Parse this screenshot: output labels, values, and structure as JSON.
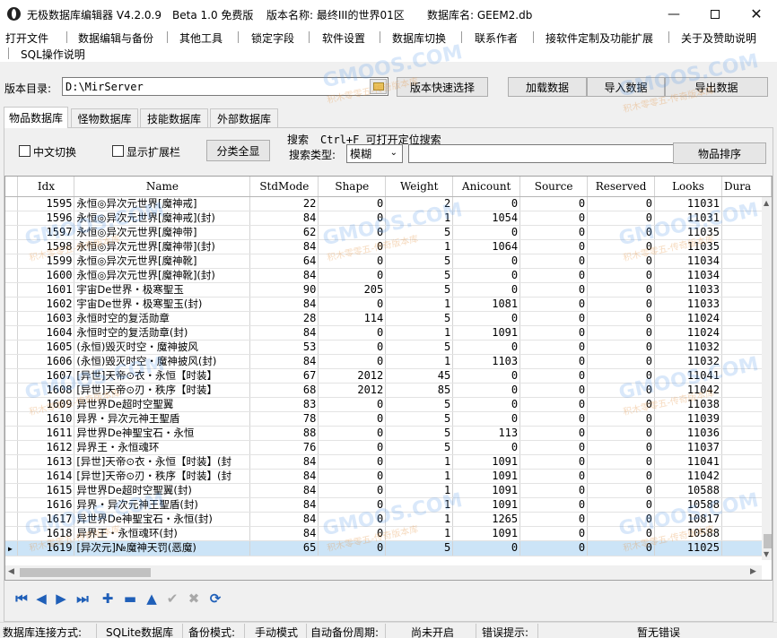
{
  "window": {
    "title": "无极数据库编辑器 V4.2.0.9",
    "edition": "Beta 1.0 免费版",
    "version_name": "版本名称: 最终III的世界01区",
    "db_name": "数据库名: GEEM2.db"
  },
  "menu": [
    "打开文件",
    "数据编辑与备份",
    "其他工具",
    "锁定字段",
    "软件设置",
    "数据库切换",
    "联系作者",
    "接软件定制及功能扩展",
    "关于及赞助说明",
    "SQL操作说明"
  ],
  "toolbar": {
    "path_label": "版本目录:",
    "path_value": "D:\\MirServer",
    "quick_select": "版本快速选择",
    "load": "加载数据",
    "import": "导入数据",
    "export": "导出数据"
  },
  "tabs": [
    "物品数据库",
    "怪物数据库",
    "技能数据库",
    "外部数据库"
  ],
  "filters": {
    "chinese_switch": "中文切换",
    "show_ext": "显示扩展栏",
    "show_all": "分类全显",
    "search_label": "搜索",
    "search_hint": "Ctrl+F 可打开定位搜索",
    "search_type_label": "搜索类型:",
    "search_type_value": "模糊",
    "sort_button": "物品排序"
  },
  "grid": {
    "columns": [
      "Idx",
      "Name",
      "StdMode",
      "Shape",
      "Weight",
      "Anicount",
      "Source",
      "Reserved",
      "Looks",
      "Dura"
    ],
    "rows": [
      [
        "1595",
        "永恒◎异次元世界[魔神戒]",
        "22",
        "0",
        "2",
        "0",
        "0",
        "0",
        "11031"
      ],
      [
        "1596",
        "永恒◎异次元世界[魔神戒](封)",
        "84",
        "0",
        "1",
        "1054",
        "0",
        "0",
        "11031"
      ],
      [
        "1597",
        "永恒◎异次元世界[魔神带]",
        "62",
        "0",
        "5",
        "0",
        "0",
        "0",
        "11035"
      ],
      [
        "1598",
        "永恒◎异次元世界[魔神带](封)",
        "84",
        "0",
        "1",
        "1064",
        "0",
        "0",
        "11035"
      ],
      [
        "1599",
        "永恒◎异次元世界[魔神靴]",
        "64",
        "0",
        "5",
        "0",
        "0",
        "0",
        "11034"
      ],
      [
        "1600",
        "永恒◎异次元世界[魔神靴](封)",
        "84",
        "0",
        "5",
        "0",
        "0",
        "0",
        "11034"
      ],
      [
        "1601",
        "宇宙De世界・极寒聖玉",
        "90",
        "205",
        "5",
        "0",
        "0",
        "0",
        "11033"
      ],
      [
        "1602",
        "宇宙De世界・极寒聖玉(封)",
        "84",
        "0",
        "1",
        "1081",
        "0",
        "0",
        "11033"
      ],
      [
        "1603",
        "永恒时空的复活勋章",
        "28",
        "114",
        "5",
        "0",
        "0",
        "0",
        "11024"
      ],
      [
        "1604",
        "永恒时空的复活勋章(封)",
        "84",
        "0",
        "1",
        "1091",
        "0",
        "0",
        "11024"
      ],
      [
        "1605",
        "(永恒)毁灭时空・魔神披风",
        "53",
        "0",
        "5",
        "0",
        "0",
        "0",
        "11032"
      ],
      [
        "1606",
        "(永恒)毁灭时空・魔神披风(封)",
        "84",
        "0",
        "1",
        "1103",
        "0",
        "0",
        "11032"
      ],
      [
        "1607",
        "[异世]天帝⊙衣・永恒【时装】",
        "67",
        "2012",
        "45",
        "0",
        "0",
        "0",
        "11041"
      ],
      [
        "1608",
        "[异世]天帝⊙刃・秩序【时装】",
        "68",
        "2012",
        "85",
        "0",
        "0",
        "0",
        "11042"
      ],
      [
        "1609",
        "异世界De超时空聖翼",
        "83",
        "0",
        "5",
        "0",
        "0",
        "0",
        "11038"
      ],
      [
        "1610",
        "异界・异次元神王聖盾",
        "78",
        "0",
        "5",
        "0",
        "0",
        "0",
        "11039"
      ],
      [
        "1611",
        "异世界De神聖宝石・永恒",
        "88",
        "0",
        "5",
        "113",
        "0",
        "0",
        "11036"
      ],
      [
        "1612",
        "异界王・永恒魂环",
        "76",
        "0",
        "5",
        "0",
        "0",
        "0",
        "11037"
      ],
      [
        "1613",
        "[异世]天帝⊙衣・永恒【时装】(封",
        "84",
        "0",
        "1",
        "1091",
        "0",
        "0",
        "11041"
      ],
      [
        "1614",
        "[异世]天帝⊙刃・秩序【时装】(封",
        "84",
        "0",
        "1",
        "1091",
        "0",
        "0",
        "11042"
      ],
      [
        "1615",
        "异世界De超时空聖翼(封)",
        "84",
        "0",
        "1",
        "1091",
        "0",
        "0",
        "10588"
      ],
      [
        "1616",
        "异界・异次元神王聖盾(封)",
        "84",
        "0",
        "1",
        "1091",
        "0",
        "0",
        "10588"
      ],
      [
        "1617",
        "异世界De神聖宝石・永恒(封)",
        "84",
        "0",
        "1",
        "1265",
        "0",
        "0",
        "10817"
      ],
      [
        "1618",
        "异界王・永恒魂环(封)",
        "84",
        "0",
        "1",
        "1091",
        "0",
        "0",
        "10588"
      ],
      [
        "1619",
        "[异次元]№魔神天罚(恶魔)",
        "65",
        "0",
        "5",
        "0",
        "0",
        "0",
        "11025"
      ]
    ],
    "selected_row": 24
  },
  "nav_icons": [
    "first-icon",
    "prior-icon",
    "next-icon",
    "last-icon",
    "insert-icon",
    "delete-icon",
    "edit-icon",
    "post-icon",
    "cancel-icon",
    "refresh-icon"
  ],
  "status": {
    "conn_label": "数据库连接方式:",
    "conn_value": "SQLite数据库",
    "backup_label": "备份模式:",
    "backup_value": "手动模式",
    "period_label": "自动备份周期:",
    "period_value": "尚未开启",
    "error_label": "错误提示:",
    "error_value": "暂无错误"
  },
  "watermark": {
    "brand": "GMOOS.COM",
    "tagline": "积木零零五-传奇版本库"
  },
  "colors": {
    "selection": "#cce4f7",
    "nav_icon": "#1f5fb8"
  }
}
